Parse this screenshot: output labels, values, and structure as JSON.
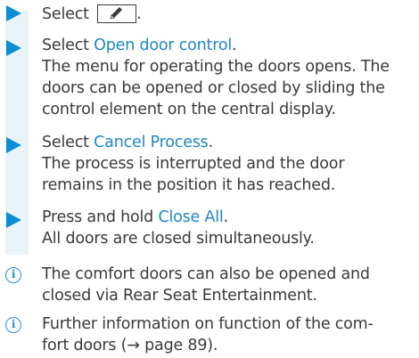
{
  "steps": [
    {
      "pre": "Select",
      "icon": "pencil-icon",
      "post": "."
    },
    {
      "pre": "Select ",
      "link": "Open door control",
      "post": ".",
      "desc": [
        "The menu for operating the doors opens. The",
        "doors can be opened or closed by sliding the",
        "control element on the central display."
      ]
    },
    {
      "pre": "Select ",
      "link": "Cancel Process",
      "post": ".",
      "desc": [
        "The process is interrupted and the door",
        "remains in the position it has reached."
      ]
    },
    {
      "pre": "Press and hold ",
      "link": "Close All",
      "post": ".",
      "desc": [
        "All doors are closed simultaneously."
      ]
    }
  ],
  "notes": [
    {
      "icon": "info-icon",
      "lines": [
        "The comfort doors can also be opened and",
        "closed via Rear Seat Entertainment."
      ]
    },
    {
      "icon": "info-icon",
      "lines": [
        "Further information on function of the com-",
        "fort doors (→ page 89)."
      ]
    }
  ],
  "colors": {
    "arrow": "#0a8fd6",
    "link": "#1e87c4",
    "info": "#2b8fc9",
    "bar": "#eaf3f9",
    "text": "#3a3a3a"
  }
}
